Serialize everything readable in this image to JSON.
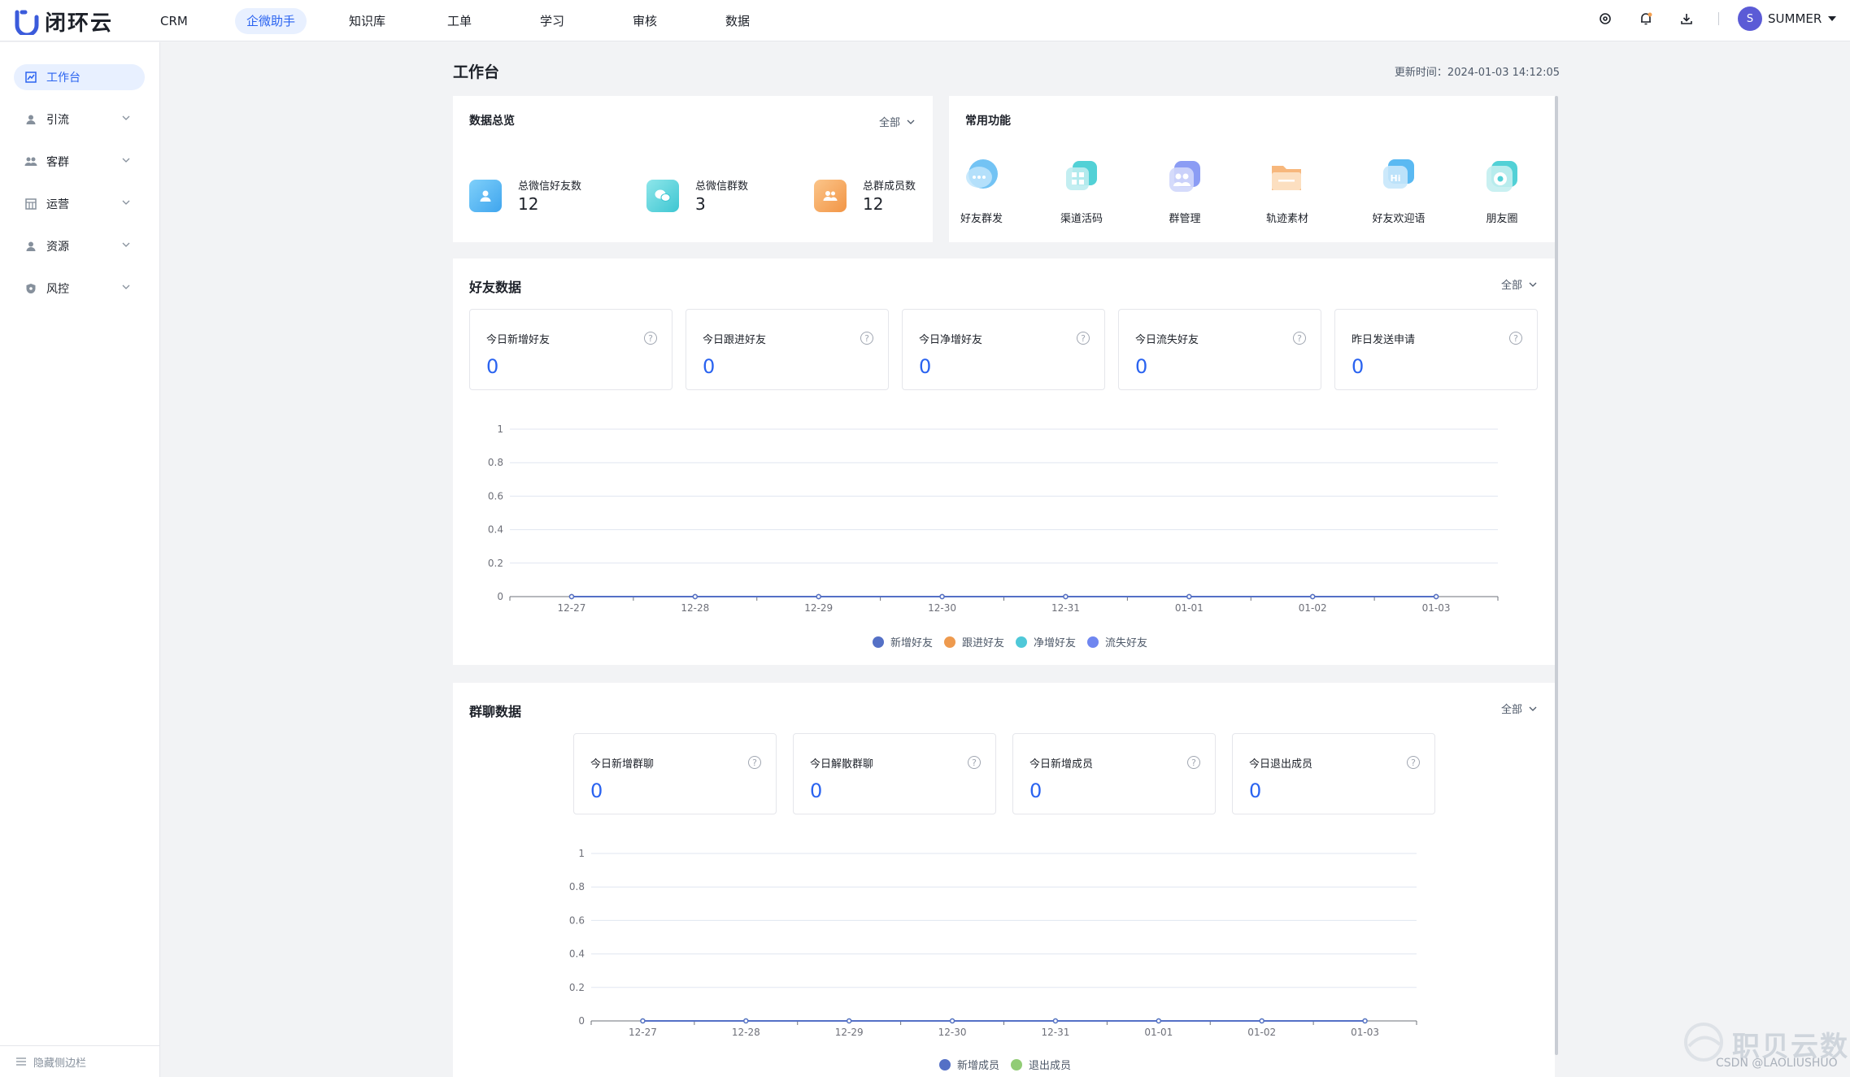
{
  "app": {
    "logo_text": "闭环云"
  },
  "nav": [
    {
      "label": "CRM",
      "active": false
    },
    {
      "label": "企微助手",
      "active": true
    },
    {
      "label": "知识库",
      "active": false
    },
    {
      "label": "工单",
      "active": false
    },
    {
      "label": "学习",
      "active": false
    },
    {
      "label": "审核",
      "active": false
    },
    {
      "label": "数据",
      "active": false
    }
  ],
  "user": {
    "initial": "S",
    "name": "SUMMER"
  },
  "sidebar": {
    "items": [
      {
        "label": "工作台",
        "icon": "chart-icon",
        "active": true
      },
      {
        "label": "引流",
        "icon": "user-icon",
        "active": false
      },
      {
        "label": "客群",
        "icon": "group-icon",
        "active": false
      },
      {
        "label": "运营",
        "icon": "table-icon",
        "active": false
      },
      {
        "label": "资源",
        "icon": "person-icon",
        "active": false
      },
      {
        "label": "风控",
        "icon": "shield-icon",
        "active": false
      }
    ],
    "footer": "隐藏侧边栏"
  },
  "page": {
    "title": "工作台",
    "update_time": "更新时间：2024-01-03 14:12:05"
  },
  "overview": {
    "title": "数据总览",
    "filter": "全部",
    "items": [
      {
        "label": "总微信好友数",
        "value": "12",
        "color": "#4fb6f5"
      },
      {
        "label": "总微信群数",
        "value": "3",
        "color": "#4fd1d9"
      },
      {
        "label": "总群成员数",
        "value": "12",
        "color": "#f5a04f"
      }
    ]
  },
  "functions": {
    "title": "常用功能",
    "items": [
      {
        "label": "好友群发",
        "color": "#5ab9f2"
      },
      {
        "label": "渠道活码",
        "color": "#52d1d6"
      },
      {
        "label": "群管理",
        "color": "#8b9cf4"
      },
      {
        "label": "轨迹素材",
        "color": "#f7b77c"
      },
      {
        "label": "好友欢迎语",
        "color": "#5ab9f2"
      },
      {
        "label": "朋友圈",
        "color": "#52d1d6"
      }
    ]
  },
  "friend_data": {
    "title": "好友数据",
    "filter": "全部",
    "stats": [
      {
        "label": "今日新增好友",
        "value": "0"
      },
      {
        "label": "今日跟进好友",
        "value": "0"
      },
      {
        "label": "今日净增好友",
        "value": "0"
      },
      {
        "label": "今日流失好友",
        "value": "0"
      },
      {
        "label": "昨日发送申请",
        "value": "0"
      }
    ]
  },
  "group_data": {
    "title": "群聊数据",
    "filter": "全部",
    "stats": [
      {
        "label": "今日新增群聊",
        "value": "0"
      },
      {
        "label": "今日解散群聊",
        "value": "0"
      },
      {
        "label": "今日新增成员",
        "value": "0"
      },
      {
        "label": "今日退出成员",
        "value": "0"
      }
    ]
  },
  "chart_data": [
    {
      "type": "line",
      "categories": [
        "12-27",
        "12-28",
        "12-29",
        "12-30",
        "12-31",
        "01-01",
        "01-02",
        "01-03"
      ],
      "ylim": [
        0,
        1
      ],
      "yticks": [
        "0",
        "0.2",
        "0.4",
        "0.6",
        "0.8",
        "1"
      ],
      "series": [
        {
          "name": "新增好友",
          "color": "#5470c6",
          "values": [
            0,
            0,
            0,
            0,
            0,
            0,
            0,
            0
          ]
        },
        {
          "name": "跟进好友",
          "color": "#ee9a4e",
          "values": [
            0,
            0,
            0,
            0,
            0,
            0,
            0,
            0
          ]
        },
        {
          "name": "净增好友",
          "color": "#4fc8d8",
          "values": [
            0,
            0,
            0,
            0,
            0,
            0,
            0,
            0
          ]
        },
        {
          "name": "流失好友",
          "color": "#6f86f0",
          "values": [
            0,
            0,
            0,
            0,
            0,
            0,
            0,
            0
          ]
        }
      ]
    },
    {
      "type": "line",
      "categories": [
        "12-27",
        "12-28",
        "12-29",
        "12-30",
        "12-31",
        "01-01",
        "01-02",
        "01-03"
      ],
      "ylim": [
        0,
        1
      ],
      "yticks": [
        "0",
        "0.2",
        "0.4",
        "0.6",
        "0.8",
        "1"
      ],
      "series": [
        {
          "name": "新增成员",
          "color": "#5470c6",
          "values": [
            0,
            0,
            0,
            0,
            0,
            0,
            0,
            0
          ]
        },
        {
          "name": "退出成员",
          "color": "#91cc75",
          "values": [
            0,
            0,
            0,
            0,
            0,
            0,
            0,
            0
          ]
        }
      ]
    }
  ],
  "watermark": {
    "brand": "职贝云数",
    "credit": "CSDN @LAOLIUSHUO"
  }
}
